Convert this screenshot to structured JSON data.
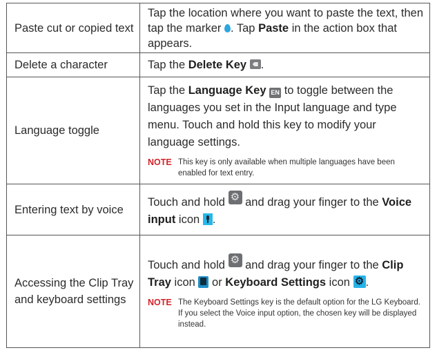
{
  "rows": [
    {
      "label": "Paste cut or copied text",
      "t1": "Tap the location where you want to paste the text, then tap the marker",
      "t2": ". Tap",
      "b1": "Paste",
      "t3": "in the action box that appears."
    },
    {
      "label": "Delete a character",
      "t1": "Tap the",
      "b1": "Delete Key",
      "t2": "."
    },
    {
      "label": "Language toggle",
      "t1": "Tap the",
      "b1": "Language Key",
      "en_icon_text": "EN",
      "t2": "to toggle between the languages you set in the Input language and type menu. Touch and hold this key to modify your language settings.",
      "note_label": "NOTE",
      "note_text": "This key is only available when multiple languages have been enabled for text entry."
    },
    {
      "label": "Entering text by voice",
      "t1": "Touch and hold",
      "t2": "and drag your finger to the",
      "b1": "Voice input",
      "t3": "icon",
      "t4": "."
    },
    {
      "label": "Accessing the Clip Tray and keyboard settings",
      "t1": "Touch and hold",
      "t2": "and drag your finger to the",
      "b1": "Clip Tray",
      "t3": "icon",
      "t4": "or",
      "b2": "Keyboard Settings",
      "t5": "icon",
      "t6": ".",
      "note_label": "NOTE",
      "note_text": "The Keyboard Settings key is the default option for the LG Keyboard. If you select the Voice input option, the chosen key will be displayed instead."
    }
  ]
}
